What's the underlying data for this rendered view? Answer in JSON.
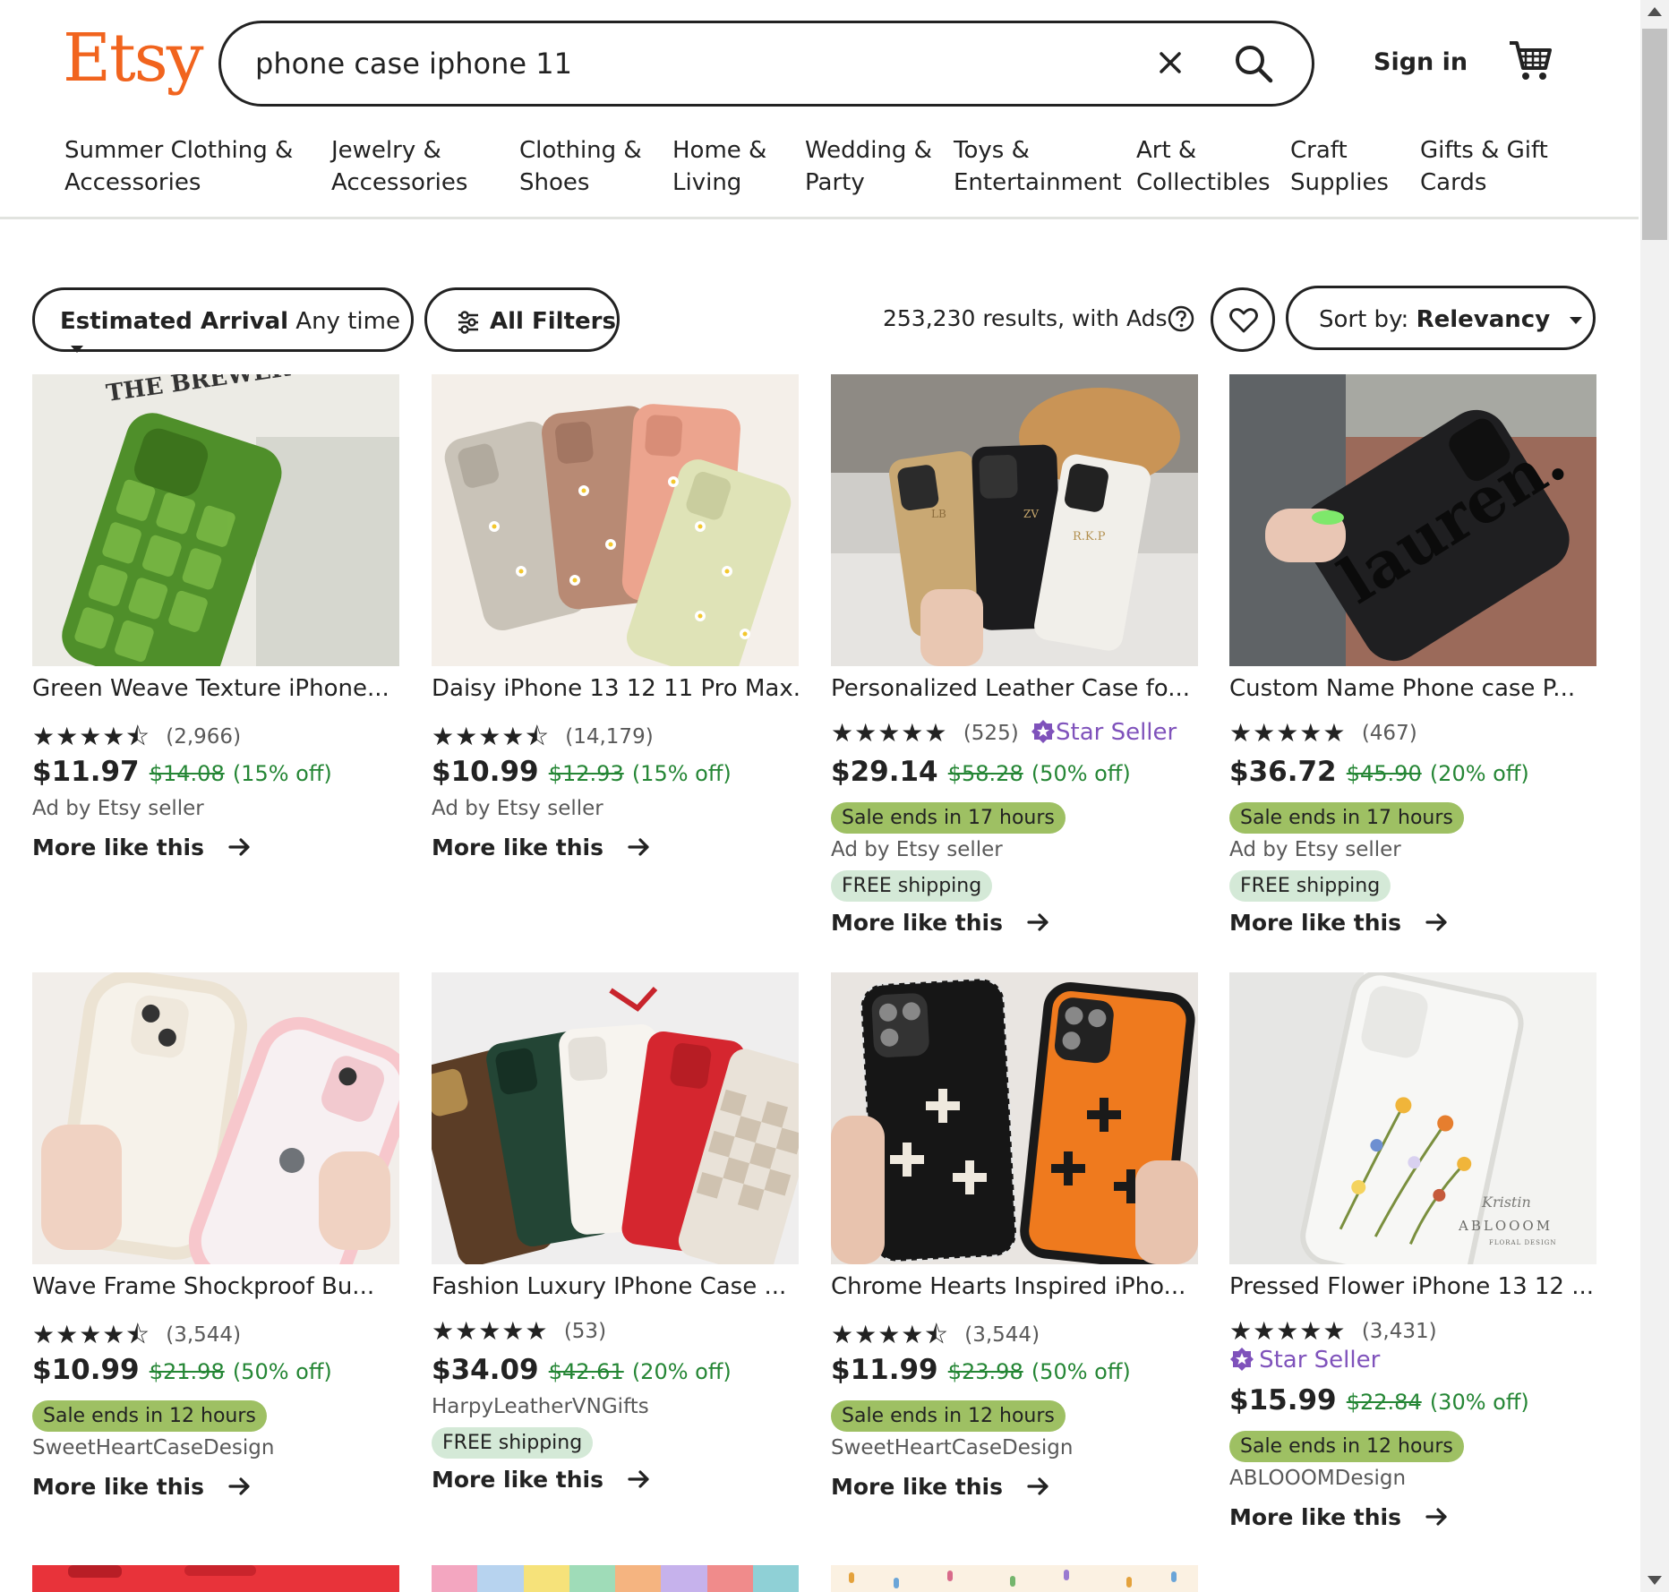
{
  "header": {
    "logo": "Etsy",
    "search_value": "phone case iphone 11",
    "sign_in": "Sign in",
    "categories": [
      [
        "Summer Clothing &",
        "Accessories"
      ],
      [
        "Jewelry &",
        "Accessories"
      ],
      [
        "Clothing &",
        "Shoes"
      ],
      [
        "Home &",
        "Living"
      ],
      [
        "Wedding &",
        "Party"
      ],
      [
        "Toys &",
        "Entertainment"
      ],
      [
        "Art &",
        "Collectibles"
      ],
      [
        "Craft",
        "Supplies"
      ],
      [
        "Gifts & Gift",
        "Cards"
      ]
    ]
  },
  "filters": {
    "arrival_label": "Estimated Arrival",
    "arrival_value": "Any time",
    "all_filters": "All Filters",
    "results": "253,230 results, with Ads",
    "sort_label": "Sort by:",
    "sort_value": "Relevancy"
  },
  "listings": [
    {
      "title": "Green Weave Texture iPhone...",
      "rating": 4.5,
      "reviews": "(2,966)",
      "star_seller": false,
      "price": "$11.97",
      "original": "$14.08",
      "discount": "(15% off)",
      "sale": "",
      "seller": "Ad by Etsy seller",
      "free_shipping": false,
      "more": "More like this"
    },
    {
      "title": "Daisy iPhone 13 12 11 Pro Max...",
      "rating": 4.5,
      "reviews": "(14,179)",
      "star_seller": false,
      "price": "$10.99",
      "original": "$12.93",
      "discount": "(15% off)",
      "sale": "",
      "seller": "Ad by Etsy seller",
      "free_shipping": false,
      "more": "More like this"
    },
    {
      "title": "Personalized Leather Case fo...",
      "rating": 5,
      "reviews": "(525)",
      "star_seller": true,
      "star_seller_label": "Star Seller",
      "price": "$29.14",
      "original": "$58.28",
      "discount": "(50% off)",
      "sale": "Sale ends in 17 hours",
      "seller": "Ad by Etsy seller",
      "free_shipping": true,
      "free_label": "FREE shipping",
      "more": "More like this"
    },
    {
      "title": "Custom Name Phone case P...",
      "rating": 5,
      "reviews": "(467)",
      "star_seller": false,
      "price": "$36.72",
      "original": "$45.90",
      "discount": "(20% off)",
      "sale": "Sale ends in 17 hours",
      "seller": "Ad by Etsy seller",
      "free_shipping": true,
      "free_label": "FREE shipping",
      "more": "More like this"
    },
    {
      "title": "Wave Frame Shockproof Bu...",
      "rating": 4.5,
      "reviews": "(3,544)",
      "star_seller": false,
      "price": "$10.99",
      "original": "$21.98",
      "discount": "(50% off)",
      "sale": "Sale ends in 12 hours",
      "seller": "SweetHeartCaseDesign",
      "free_shipping": false,
      "more": "More like this"
    },
    {
      "title": "Fashion Luxury IPhone Case ...",
      "rating": 5,
      "reviews": "(53)",
      "star_seller": false,
      "price": "$34.09",
      "original": "$42.61",
      "discount": "(20% off)",
      "sale": "",
      "seller": "HarpyLeatherVNGifts",
      "free_shipping": true,
      "free_label": "FREE shipping",
      "more": "More like this"
    },
    {
      "title": "Chrome Hearts Inspired iPho...",
      "rating": 4.5,
      "reviews": "(3,544)",
      "star_seller": false,
      "price": "$11.99",
      "original": "$23.98",
      "discount": "(50% off)",
      "sale": "Sale ends in 12 hours",
      "seller": "SweetHeartCaseDesign",
      "free_shipping": false,
      "more": "More like this"
    },
    {
      "title": "Pressed Flower iPhone 13 12 ...",
      "rating": 5,
      "reviews": "(3,431)",
      "star_seller": true,
      "star_seller_label": "Star Seller",
      "price": "$15.99",
      "original": "$22.84",
      "discount": "(30% off)",
      "sale": "Sale ends in 12 hours",
      "seller": "ABLOOOMDesign",
      "free_shipping": false,
      "more": "More like this"
    }
  ],
  "image_texts": {
    "brewery": "THE BREWER",
    "initials_1": "LB",
    "initials_2": "ZV",
    "initials_3": "R.K.P",
    "name_case": "lauren.",
    "watermark": "Kristin",
    "shop_mark": "ABLOOOM",
    "shop_sub": "FLORAL DESIGN"
  },
  "colors": {
    "brand": "#f1641e",
    "sale_badge": "#9ec063",
    "free_badge": "#d4e9d7",
    "discount": "#258635",
    "star_seller": "#7f52bb"
  }
}
